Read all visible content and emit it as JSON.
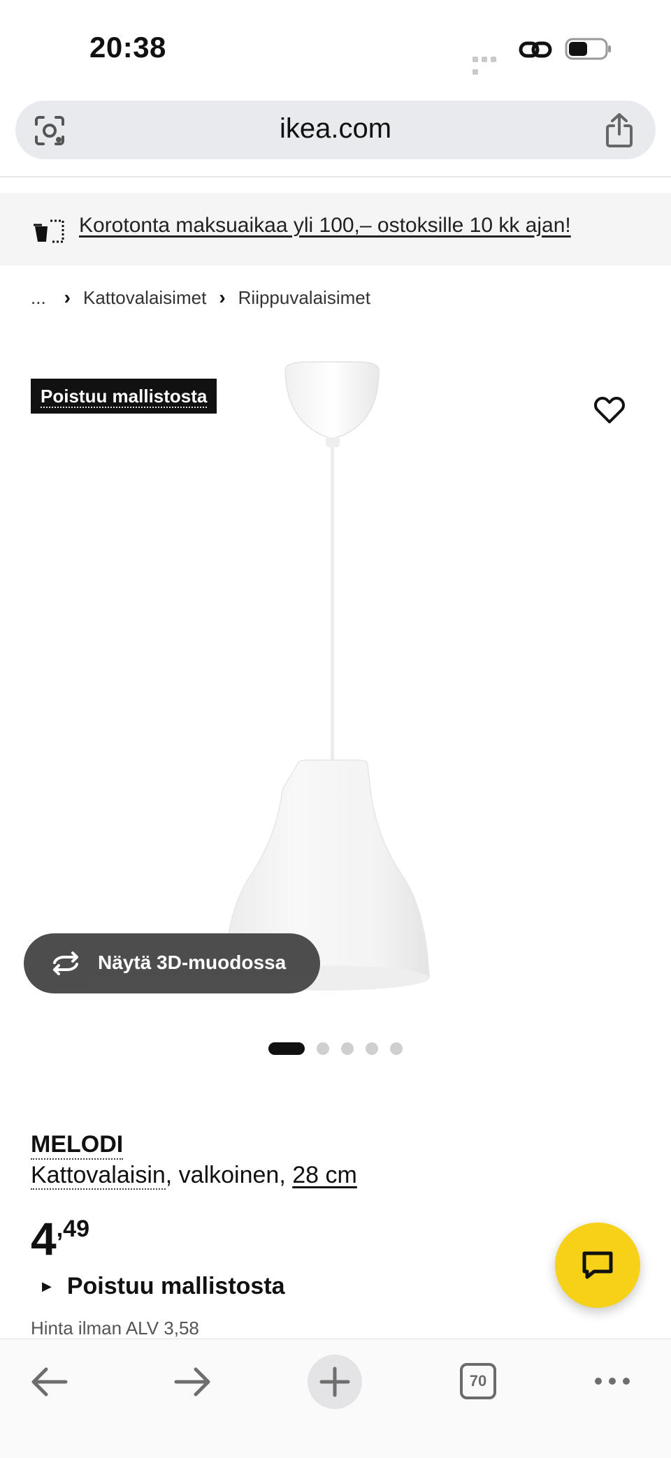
{
  "status_bar": {
    "time": "20:38"
  },
  "browser": {
    "url": "ikea.com"
  },
  "promo": {
    "text": "Korotonta maksuaikaa yli 100,– ostoksille 10 kk ajan!"
  },
  "breadcrumb": {
    "ellipsis": "...",
    "items": [
      "Kattovalaisimet",
      "Riippuvalaisimet"
    ]
  },
  "product_image": {
    "badge": "Poistuu mallistosta",
    "view_3d_label": "Näytä 3D-muodossa",
    "gallery_count": 5,
    "gallery_active": 1
  },
  "product": {
    "name": "MELODI",
    "type": "Kattovalaisin",
    "color": ", valkoinen, ",
    "size": "28 cm",
    "price_int": "4",
    "price_dec": ",49",
    "availability": "Poistuu mallistosta",
    "vat_text": "Hinta ilman ALV 3,58"
  },
  "toolbar": {
    "tabs_count": "70"
  },
  "colors": {
    "chat_button": "#f7d117",
    "badge_bg": "#111111",
    "view3d_bg": "#4a4a4a"
  }
}
